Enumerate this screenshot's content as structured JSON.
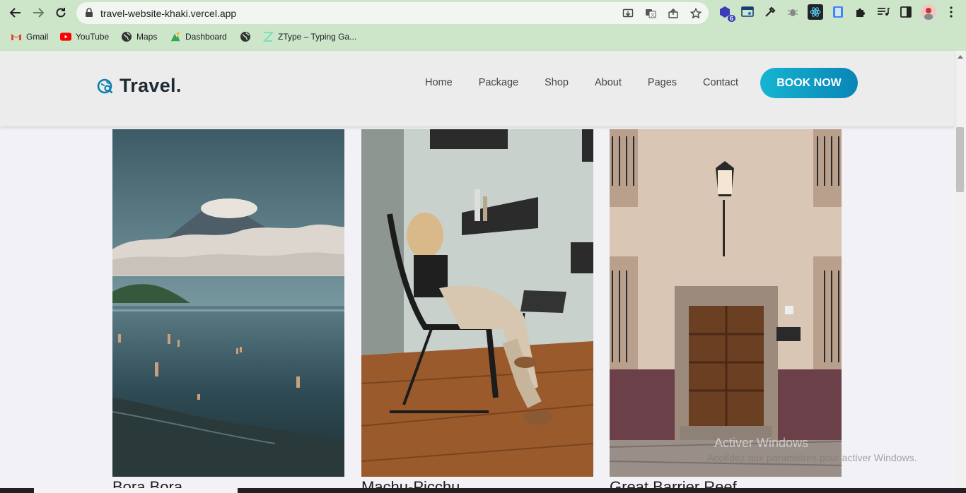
{
  "browser": {
    "url": "travel-website-khaki.vercel.app",
    "extension_badge": "6",
    "bookmarks": [
      {
        "label": "Gmail",
        "icon": "gmail-icon"
      },
      {
        "label": "YouTube",
        "icon": "youtube-icon"
      },
      {
        "label": "Maps",
        "icon": "globe-icon"
      },
      {
        "label": "Dashboard",
        "icon": "dashboard-icon"
      },
      {
        "label": "",
        "icon": "globe-icon"
      },
      {
        "label": "ZType – Typing Ga...",
        "icon": "ztype-icon"
      }
    ]
  },
  "site": {
    "brand": "Travel.",
    "nav": [
      "Home",
      "Package",
      "Shop",
      "About",
      "Pages",
      "Contact"
    ],
    "cta": "BOOK NOW",
    "accent_from": "#16b4d2",
    "accent_to": "#0886b6"
  },
  "destinations": [
    {
      "name": "Bora Bora"
    },
    {
      "name": "Machu-Picchu"
    },
    {
      "name": "Great Barrier Reef"
    }
  ],
  "watermark": {
    "title": "Activer Windows",
    "subtitle": "Accédez aux paramètres pour activer Windows."
  }
}
